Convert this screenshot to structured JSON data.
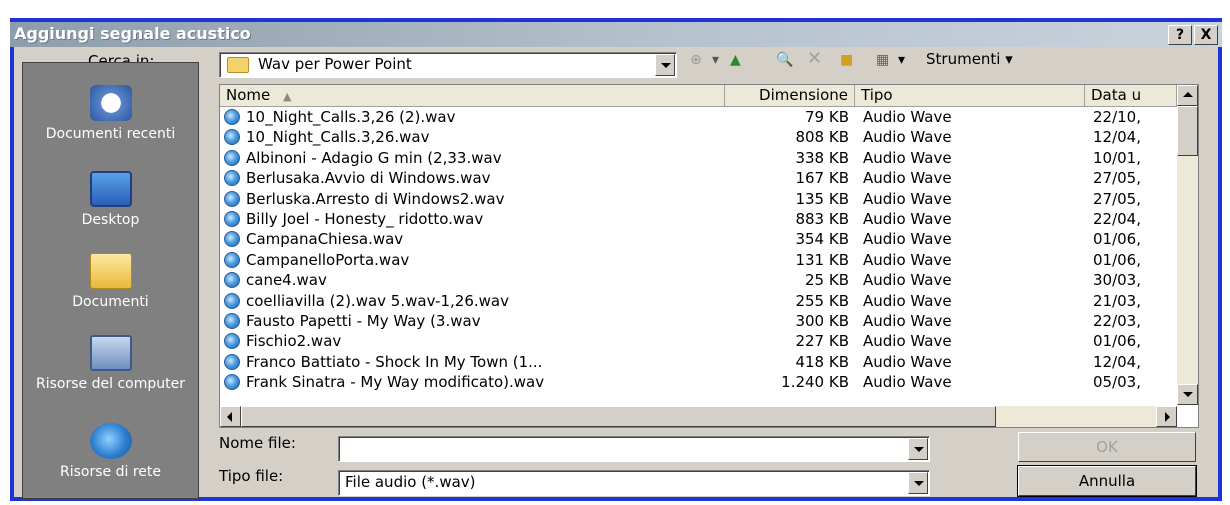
{
  "window": {
    "title": "Aggiungi segnale acustico",
    "help_label": "?",
    "close_label": "X"
  },
  "lookin": {
    "label": "Cerca in:",
    "value": "Wav per Power Point",
    "tools_label": "Strumenti"
  },
  "places": [
    {
      "name": "documenti-recenti",
      "label": "Documenti recenti"
    },
    {
      "name": "desktop",
      "label": "Desktop"
    },
    {
      "name": "documenti",
      "label": "Documenti"
    },
    {
      "name": "risorse-del-computer",
      "label": "Risorse del computer"
    },
    {
      "name": "risorse-di-rete",
      "label": "Risorse di rete"
    }
  ],
  "columns": [
    "Nome",
    "Dimensione",
    "Tipo",
    "Data u"
  ],
  "files": [
    {
      "name": "10_Night_Calls.3,26 (2).wav",
      "size": "79 KB",
      "type": "Audio Wave",
      "date": "22/10,"
    },
    {
      "name": "10_Night_Calls.3,26.wav",
      "size": "808 KB",
      "type": "Audio Wave",
      "date": "12/04,"
    },
    {
      "name": "Albinoni - Adagio G min (2,33.wav",
      "size": "338 KB",
      "type": "Audio Wave",
      "date": "10/01,"
    },
    {
      "name": "Berlusaka.Avvio di Windows.wav",
      "size": "167 KB",
      "type": "Audio Wave",
      "date": "27/05,"
    },
    {
      "name": "Berluska.Arresto di Windows2.wav",
      "size": "135 KB",
      "type": "Audio Wave",
      "date": "27/05,"
    },
    {
      "name": "Billy Joel - Honesty_ ridotto.wav",
      "size": "883 KB",
      "type": "Audio Wave",
      "date": "22/04,"
    },
    {
      "name": "CampanaChiesa.wav",
      "size": "354 KB",
      "type": "Audio Wave",
      "date": "01/06,"
    },
    {
      "name": "CampanelloPorta.wav",
      "size": "131 KB",
      "type": "Audio Wave",
      "date": "01/06,"
    },
    {
      "name": "cane4.wav",
      "size": "25 KB",
      "type": "Audio Wave",
      "date": "30/03,"
    },
    {
      "name": "coelliavilla (2).wav 5.wav-1,26.wav",
      "size": "255 KB",
      "type": "Audio Wave",
      "date": "21/03,"
    },
    {
      "name": "Fausto Papetti - My Way (3.wav",
      "size": "300 KB",
      "type": "Audio Wave",
      "date": "22/03,"
    },
    {
      "name": "Fischio2.wav",
      "size": "227 KB",
      "type": "Audio Wave",
      "date": "01/06,"
    },
    {
      "name": "Franco Battiato - Shock In My Town (1...",
      "size": "418 KB",
      "type": "Audio Wave",
      "date": "12/04,"
    },
    {
      "name": "Frank Sinatra - My Way modificato).wav",
      "size": "1.240 KB",
      "type": "Audio Wave",
      "date": "05/03,"
    }
  ],
  "filename": {
    "label": "Nome file:",
    "value": ""
  },
  "filetype": {
    "label": "Tipo file:",
    "value": "File audio (*.wav)"
  },
  "buttons": {
    "ok": "OK",
    "cancel": "Annulla"
  }
}
